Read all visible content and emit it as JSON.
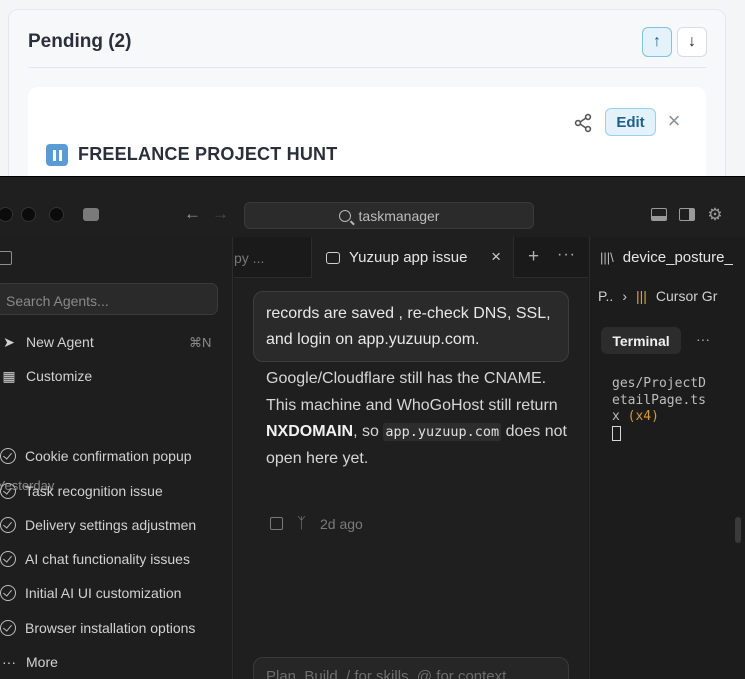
{
  "background_app": {
    "section_title": "Pending (2)",
    "edit_label": "Edit",
    "project_title": "FREELANCE PROJECT HUNT"
  },
  "ide": {
    "search_text": "taskmanager",
    "sidebar": {
      "search_placeholder": "Search Agents...",
      "new_agent_label": "New Agent",
      "new_agent_shortcut": "⌘N",
      "customize_label": "Customize",
      "section_yesterday": "Yesterday",
      "items": [
        "Cookie confirmation popup",
        "Task recognition issue",
        "Delivery settings adjustmen",
        "AI chat functionality issues",
        "Initial AI UI customization",
        "Browser installation options"
      ],
      "more_label": "More"
    },
    "tabs": {
      "previous_tab": "py ...",
      "active_tab": "Yuzuup app issue"
    },
    "chat": {
      "user_message": "records are saved , re-check DNS, SSL, and login on app.yuzuup.com.",
      "reply_part1": "Google/Cloudflare still has the CNAME. This machine and WhoGoHost still return ",
      "reply_bold": "NXDOMAIN",
      "reply_part2": ", so ",
      "reply_code": "app.yuzuup.com",
      "reply_part3": " does not open here yet.",
      "timestamp": "2d ago",
      "composer_placeholder": "Plan, Build, / for skills, @ for context"
    },
    "right_panel": {
      "tab_label": "device_posture_",
      "crumb_first": "P..",
      "crumb_last": "Cursor Gr",
      "terminal_tab": "Terminal",
      "terminal_line1": "ges/ProjectD",
      "terminal_line2": "etailPage.ts",
      "terminal_line3_a": "x ",
      "terminal_line3_b": "(x4)"
    }
  },
  "colors": {
    "accent_blue": "#7cc3e8",
    "edit_bg": "#e2f1fa",
    "ide_bg": "#1c1c1c",
    "terminal_highlight": "#d89a2b"
  }
}
